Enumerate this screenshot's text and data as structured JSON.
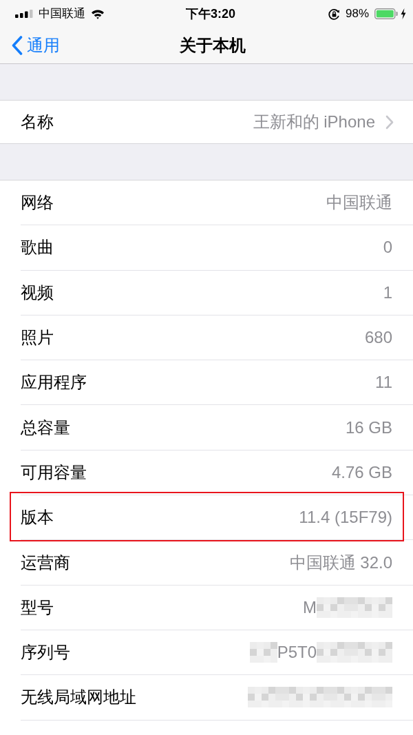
{
  "status_bar": {
    "carrier": "中国联通",
    "time": "下午3:20",
    "battery": "98%"
  },
  "nav_bar": {
    "back": "通用",
    "title": "关于本机"
  },
  "groups": [
    {
      "rows": [
        {
          "kind": "link",
          "label": "名称",
          "value": "王新和的 iPhone",
          "highlighted": false
        }
      ]
    },
    {
      "rows": [
        {
          "kind": "info",
          "label": "网络",
          "value": "中国联通",
          "highlighted": false
        },
        {
          "kind": "info",
          "label": "歌曲",
          "value": "0",
          "highlighted": false
        },
        {
          "kind": "info",
          "label": "视频",
          "value": "1",
          "highlighted": false
        },
        {
          "kind": "info",
          "label": "照片",
          "value": "680",
          "highlighted": false
        },
        {
          "kind": "info",
          "label": "应用程序",
          "value": "11",
          "highlighted": false
        },
        {
          "kind": "info",
          "label": "总容量",
          "value": "16 GB",
          "highlighted": false
        },
        {
          "kind": "info",
          "label": "可用容量",
          "value": "4.76 GB",
          "highlighted": false
        },
        {
          "kind": "info",
          "label": "版本",
          "value": "11.4 (15F79)",
          "highlighted": true
        },
        {
          "kind": "info",
          "label": "运营商",
          "value": "中国联通 32.0",
          "highlighted": false
        },
        {
          "kind": "info",
          "label": "型号",
          "value_parts": [
            {
              "kind": "text",
              "text": "M"
            },
            {
              "kind": "mosaic"
            }
          ],
          "highlighted": false
        },
        {
          "kind": "info",
          "label": "序列号",
          "value_parts": [
            {
              "kind": "mosaic"
            },
            {
              "kind": "text",
              "text": "P5T0"
            },
            {
              "kind": "mosaic"
            }
          ],
          "highlighted": false
        },
        {
          "kind": "info",
          "label": "无线局域网地址",
          "value_parts": [
            {
              "kind": "mosaic"
            }
          ],
          "highlighted": false
        }
      ]
    }
  ]
}
